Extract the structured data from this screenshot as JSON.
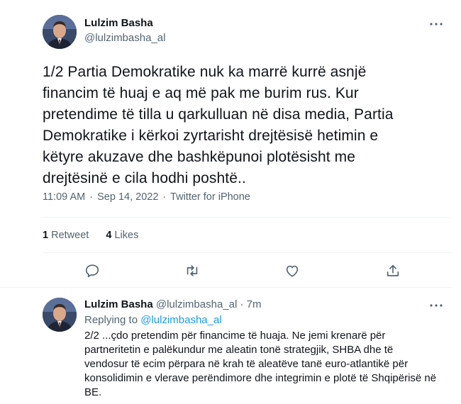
{
  "main_tweet": {
    "author_name": "Lulzim Basha",
    "author_handle": "@lulzimbasha_al",
    "text": "1/2 Partia Demokratike nuk ka marrë kurrë asnjë financim të huaj e aq më pak me burim rus. Kur pretendime të tilla u qarkulluan në disa media, Partia Demokratike i kërkoi zyrtarisht drejtësisë hetimin e këtyre akuzave dhe bashkëpunoi plotësisht me drejtësinë e cila hodhi poshtë..",
    "time": "11:09 AM",
    "dot": "·",
    "date": "Sep 14, 2022",
    "source": "Twitter for iPhone",
    "retweets_count": "1",
    "retweets_label": "Retweet",
    "likes_count": "4",
    "likes_label": "Likes"
  },
  "reply_tweet": {
    "author_name": "Lulzim Basha",
    "author_handle": "@lulzimbasha_al",
    "dot": "·",
    "time_ago": "7m",
    "replying_to_label": "Replying to",
    "replying_to_handle": "@lulzimbasha_al",
    "text": "2/2 ...çdo pretendim për financime të huaja. Ne jemi krenarë për partneritetin e palëkundur me aleatin tonë strategjik, SHBA dhe të vendosur të ecim përpara në krah të aleatëve tanë euro-atlantikë për konsolidimin e vlerave perëndimore dhe integrimin e plotë të Shqipërisë në BE."
  },
  "icons": [
    "reply-icon",
    "retweet-icon",
    "like-icon",
    "share-icon",
    "more-icon",
    "avatar"
  ],
  "colors": {
    "text": "#0f1419",
    "secondary": "#536471",
    "link": "#1d9bf0",
    "divider": "#eff3f4"
  }
}
